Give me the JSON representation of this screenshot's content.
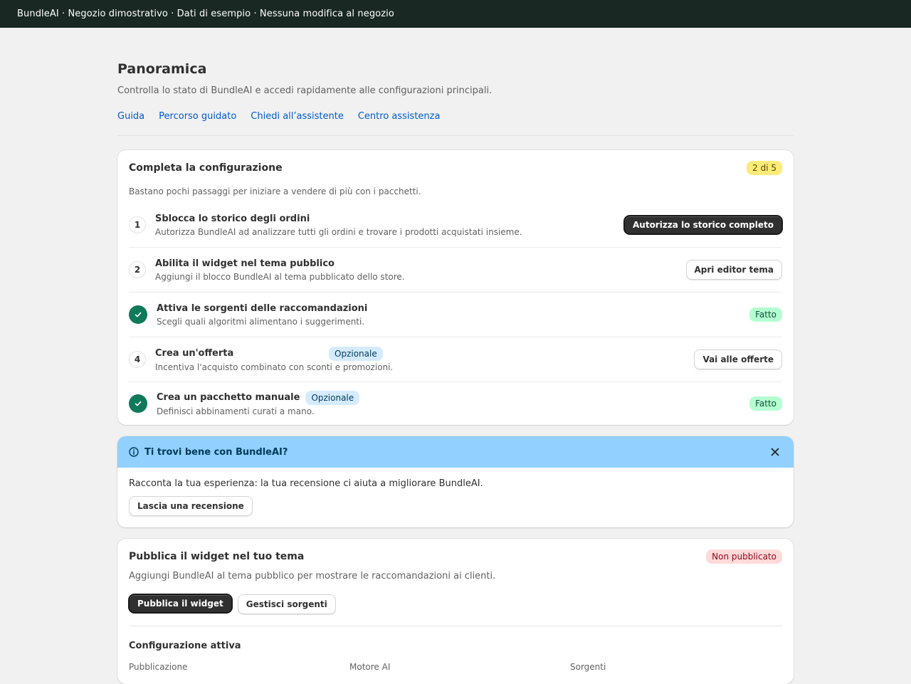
{
  "topbar": {
    "text": "BundleAI · Negozio dimostrativo · Dati di esempio · Nessuna modifica al negozio"
  },
  "header": {
    "title": "Panoramica",
    "subtitle": "Controlla lo stato di BundleAI e accedi rapidamente alle configurazioni principali.",
    "links": [
      "Guida",
      "Percorso guidato",
      "Chiedi all’assistente",
      "Centro assistenza"
    ]
  },
  "setup": {
    "title": "Completa la configurazione",
    "progress_badge": "2 di 5",
    "description": "Bastano pochi passaggi per iniziare a vendere di più con i pacchetti.",
    "steps": [
      {
        "number": "1",
        "title": "Sblocca lo storico degli ordini",
        "description": "Autorizza BundleAI ad analizzare tutti gli ordini e trovare i prodotti acquistati insieme.",
        "action": "Autorizza lo storico completo"
      },
      {
        "number": "2",
        "title": "Abilita il widget nel tema pubblico",
        "description": "Aggiungi il blocco BundleAI al tema pubblicato dello store.",
        "action": "Apri editor tema"
      },
      {
        "title": "Attiva le sorgenti delle raccomandazioni",
        "description": "Scegli quali algoritmi alimentano i suggerimenti.",
        "status": "Fatto"
      },
      {
        "number": "4",
        "title": "Crea un'offerta",
        "tag": "Opzionale",
        "description": "Incentiva l'acquisto combinato con sconti e promozioni.",
        "action": "Vai alle offerte"
      },
      {
        "title": "Crea un pacchetto manuale",
        "tag": "Opzionale",
        "description": "Definisci abbinamenti curati a mano.",
        "status": "Fatto"
      }
    ]
  },
  "review_banner": {
    "title": "Ti trovi bene con BundleAI?",
    "text": "Racconta la tua esperienza: la tua recensione ci aiuta a migliorare BundleAI.",
    "button": "Lascia una recensione"
  },
  "publish": {
    "title": "Pubblica il widget nel tuo tema",
    "status_badge": "Non pubblicato",
    "description": "Aggiungi BundleAI al tema pubblico per mostrare le raccomandazioni ai clienti.",
    "primary_button": "Pubblica il widget",
    "secondary_button": "Gestisci sorgenti",
    "config_title": "Configurazione attiva",
    "config": [
      {
        "label": "Pubblicazione"
      },
      {
        "label": "Motore AI"
      },
      {
        "label": "Sorgenti"
      }
    ]
  },
  "colors": {
    "topbar": "#1a2824",
    "accent_link": "#005bd3",
    "success": "#0f7a5a",
    "banner_info": "#91d0ff",
    "primary_button": "#303030"
  },
  "icons": {
    "check": "check-icon",
    "info": "info-icon",
    "close": "close-icon"
  }
}
